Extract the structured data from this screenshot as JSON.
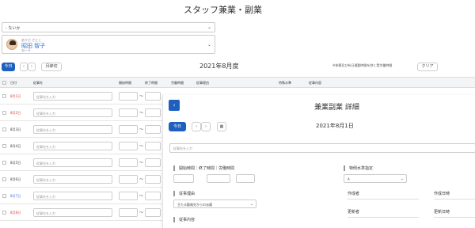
{
  "header": {
    "title": "スタッフ兼業・副業"
  },
  "filter": {
    "select_value": "- ないか"
  },
  "user": {
    "kana": "ありだ さとこ",
    "name": "昭田 智子",
    "sub": "ねーそ"
  },
  "toolbar": {
    "today": "今日",
    "prev": "‹",
    "next": "›",
    "monthly": "月締切",
    "month": "2021年8月度",
    "note": "※休憩及び有日通勤時間を除く実労働時間",
    "clear": "クリア"
  },
  "table": {
    "headers": [
      "日付",
      "従事先",
      "開始時間",
      "終了時間",
      "労働時間",
      "従事理由",
      "特殊水準",
      "従事内容"
    ],
    "input_placeholder": "従事先を入力",
    "rows": [
      {
        "date": "8月1日",
        "style": "sun"
      },
      {
        "date": "8月2日",
        "style": "sun"
      },
      {
        "date": "8月3日",
        "style": ""
      },
      {
        "date": "8月4日",
        "style": ""
      },
      {
        "date": "8月5日",
        "style": ""
      },
      {
        "date": "8月6日",
        "style": ""
      },
      {
        "date": "8月7日",
        "style": "sat"
      },
      {
        "date": "8月8日",
        "style": "sun"
      }
    ]
  },
  "detail": {
    "title": "兼業副業 詳細",
    "date": "2021年8月1日",
    "today": "今日",
    "placeholder": "従事先を入力",
    "time_label": "開始時間｜終了時間｜労働時間",
    "special_label": "特例水準指定",
    "special_value": "A",
    "reason_label": "従事理由",
    "reason_value": "主たる勤務先からの派遣",
    "creator_label": "作成者",
    "created_label": "作成日時",
    "updater_label": "更新者",
    "updated_label": "更新日時",
    "content_label": "従事内容"
  }
}
